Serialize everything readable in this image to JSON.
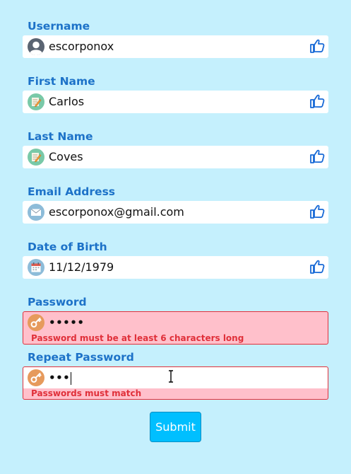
{
  "form": {
    "fields": [
      {
        "label": "Username",
        "value": "escorponox",
        "icon": "user-icon",
        "status_icon": "thumbs-up-icon"
      },
      {
        "label": "First Name",
        "value": "Carlos",
        "icon": "edit-note-icon",
        "status_icon": "thumbs-up-icon"
      },
      {
        "label": "Last Name",
        "value": "Coves",
        "icon": "edit-note-icon",
        "status_icon": "thumbs-up-icon"
      },
      {
        "label": "Email Address",
        "value": "escorponox@gmail.com",
        "icon": "envelope-icon",
        "status_icon": "thumbs-up-icon"
      },
      {
        "label": "Date of Birth",
        "value": "11/12/1979",
        "icon": "calendar-icon",
        "status_icon": "thumbs-up-icon"
      },
      {
        "label": "Password",
        "value": "•••••",
        "icon": "key-icon",
        "error": "Password must be at least 6 characters long"
      },
      {
        "label": "Repeat Password",
        "value": "•••",
        "icon": "key-icon",
        "error": "Passwords must match"
      }
    ],
    "submit_label": "Submit"
  },
  "colors": {
    "background": "#c5f0fd",
    "label": "#1d72c8",
    "error_text": "#e0303a",
    "error_background": "#ffc0cb",
    "button": "#00bfff"
  }
}
